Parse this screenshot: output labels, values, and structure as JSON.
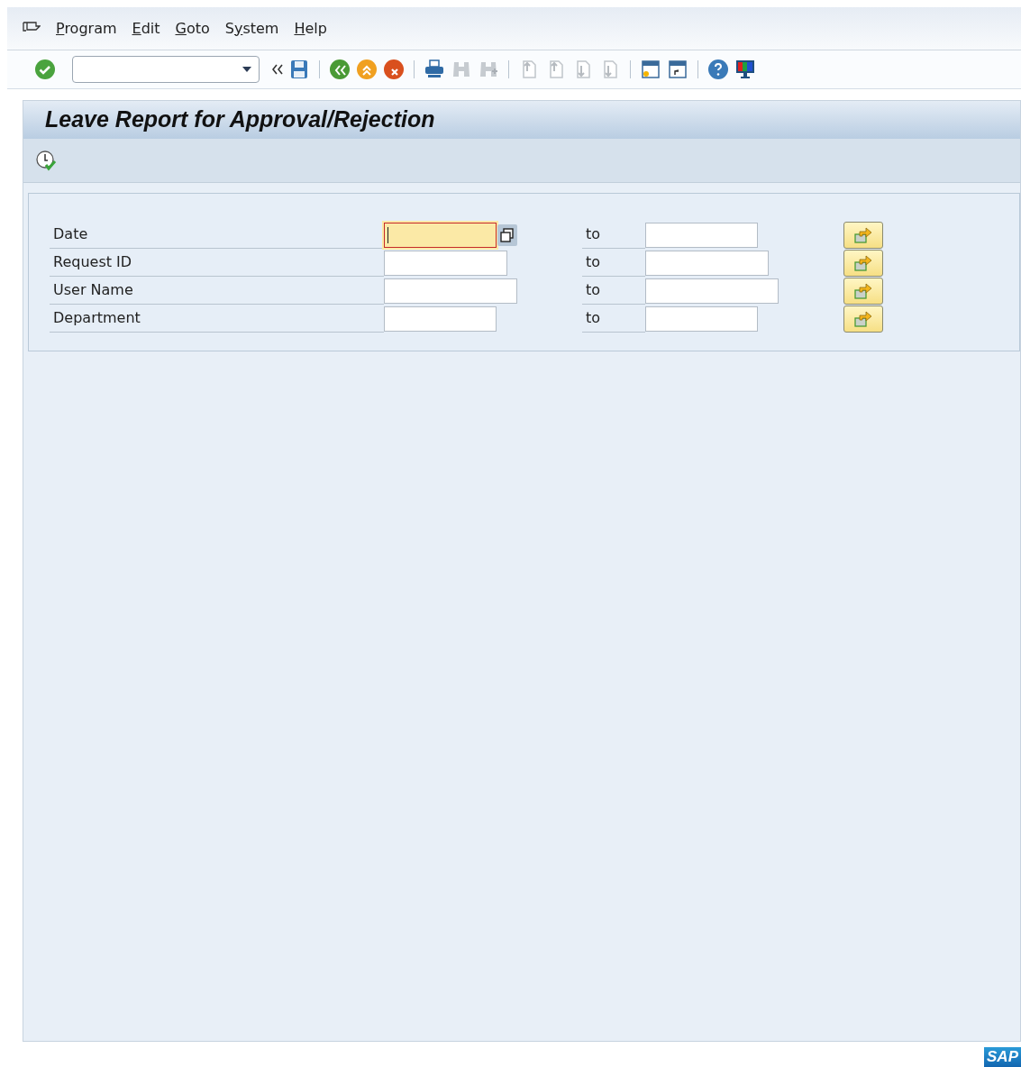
{
  "menu_bar": {
    "items": [
      {
        "key": "P",
        "rest": "rogram"
      },
      {
        "key": "E",
        "rest": "dit"
      },
      {
        "key": "G",
        "rest": "oto"
      },
      {
        "lead": "S",
        "key": "y",
        "rest": "stem"
      },
      {
        "key": "H",
        "rest": "elp"
      }
    ]
  },
  "screen": {
    "title": "Leave Report for Approval/Rejection"
  },
  "selection": {
    "rows": [
      {
        "label": "Date",
        "to_label": "to",
        "focused": true
      },
      {
        "label": "Request ID",
        "to_label": "to",
        "focused": false
      },
      {
        "label": "User Name",
        "to_label": "to",
        "focused": false
      },
      {
        "label": "Department",
        "to_label": "to",
        "focused": false
      }
    ]
  },
  "footer": {
    "logo_text": "SAP"
  }
}
